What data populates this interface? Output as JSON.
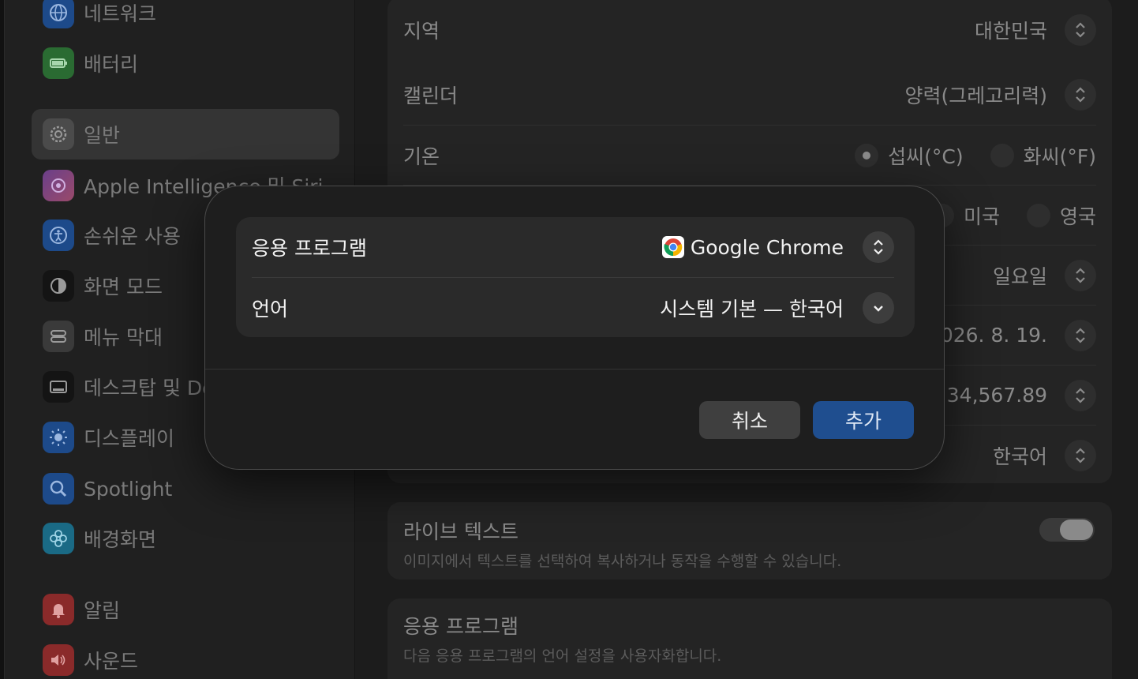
{
  "sidebar": {
    "items": [
      {
        "label": "네트워크",
        "icon": "globe-icon",
        "color": "#1d63c9"
      },
      {
        "label": "배터리",
        "icon": "battery-icon",
        "color": "#2f9a3c"
      },
      {
        "label": "일반",
        "icon": "gear-icon",
        "color": "#6e6e6e",
        "selected": true
      },
      {
        "label": "Apple Intelligence 및 Siri",
        "icon": "siri-icon",
        "color": "#b85cd6"
      },
      {
        "label": "손쉬운 사용",
        "icon": "accessibility-icon",
        "color": "#1d63c9"
      },
      {
        "label": "화면 모드",
        "icon": "appearance-icon",
        "color": "#111111"
      },
      {
        "label": "메뉴 막대",
        "icon": "menubar-icon",
        "color": "#555555"
      },
      {
        "label": "데스크탑 및 Dock",
        "icon": "dock-icon",
        "color": "#111111"
      },
      {
        "label": "디스플레이",
        "icon": "brightness-icon",
        "color": "#1d63c9"
      },
      {
        "label": "Spotlight",
        "icon": "magnifier-icon",
        "color": "#1d63c9"
      },
      {
        "label": "배경화면",
        "icon": "flower-icon",
        "color": "#1fa0c9"
      },
      {
        "label": "알림",
        "icon": "bell-icon",
        "color": "#d53a3a"
      },
      {
        "label": "사운드",
        "icon": "speaker-icon",
        "color": "#d53a3a"
      }
    ]
  },
  "settings": {
    "region": {
      "label": "지역",
      "value": "대한민국"
    },
    "calendar": {
      "label": "캘린더",
      "value": "양력(그레고리력)"
    },
    "temperature": {
      "label": "기온",
      "celsius": "섭씨(°C)",
      "fahrenheit": "화씨(°F)"
    },
    "measurement": {
      "us": "미국",
      "uk": "영국"
    },
    "first_day": {
      "value": "일요일"
    },
    "date_format": {
      "value": "026. 8. 19."
    },
    "number_format": {
      "value": "34,567.89"
    },
    "list_sort": {
      "value": "한국어"
    },
    "live_text": {
      "title": "라이브 텍스트",
      "description": "이미지에서 텍스트를 선택하여 복사하거나 동작을 수행할 수 있습니다."
    },
    "applications": {
      "title": "응용 프로그램",
      "description": "다음 응용 프로그램의 언어 설정을 사용자화합니다."
    }
  },
  "dialog": {
    "app_label": "응용 프로그램",
    "app_value": "Google Chrome",
    "language_label": "언어",
    "language_value": "시스템 기본 — 한국어",
    "cancel_label": "취소",
    "add_label": "추가",
    "accent_color": "#1f4e8f"
  }
}
